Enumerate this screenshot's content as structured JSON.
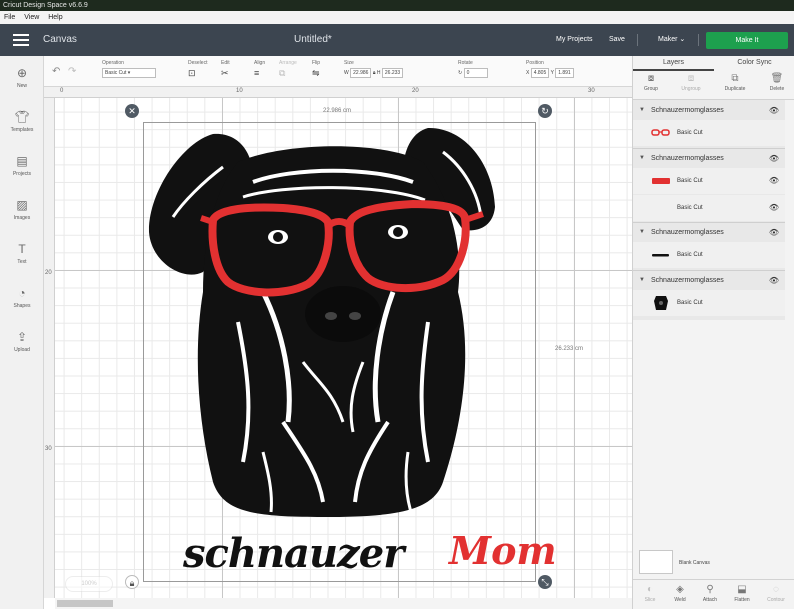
{
  "window": {
    "title": "Cricut Design Space v6.6.9"
  },
  "menu": {
    "items": [
      "File",
      "View",
      "Help"
    ]
  },
  "header": {
    "section": "Canvas",
    "document_title": "Untitled*",
    "my_projects": "My Projects",
    "save": "Save",
    "machine": "Maker",
    "make_it": "Make It"
  },
  "toolbar": {
    "operation_label": "Operation",
    "operation_value": "Basic Cut",
    "deselect_label": "Deselect",
    "edit_label": "Edit",
    "align_label": "Align",
    "arrange_label": "Arrange",
    "flip_label": "Flip",
    "size_label": "Size",
    "size_w_prefix": "W",
    "size_w": "22.986",
    "size_h_prefix": "H",
    "size_h": "26.233",
    "rotate_label": "Rotate",
    "rotate_value": "0",
    "position_label": "Position",
    "position_x_prefix": "X",
    "position_x": "4.805",
    "position_y_prefix": "Y",
    "position_y": "1.891"
  },
  "sidebar": {
    "items": [
      {
        "label": "New",
        "icon": "plus-circle-icon"
      },
      {
        "label": "Templates",
        "icon": "shirt-icon"
      },
      {
        "label": "Projects",
        "icon": "projects-icon"
      },
      {
        "label": "Images",
        "icon": "image-icon"
      },
      {
        "label": "Text",
        "icon": "text-icon"
      },
      {
        "label": "Shapes",
        "icon": "shapes-icon"
      },
      {
        "label": "Upload",
        "icon": "upload-icon"
      }
    ]
  },
  "ruler": {
    "ticks": [
      "0",
      "10",
      "20",
      "30"
    ],
    "left_ticks": [
      "20",
      "30"
    ]
  },
  "canvas": {
    "width_dim": "22.986 cm",
    "height_dim": "26.233 cm",
    "zoom": "100%",
    "text_black": "schnauzer",
    "text_red": "Mom"
  },
  "panel": {
    "tabs": [
      "Layers",
      "Color Sync"
    ],
    "tools": [
      "Group",
      "Ungroup",
      "Duplicate",
      "Delete"
    ],
    "layer_groups": [
      {
        "name": "Schnauzermomglasses",
        "items": [
          {
            "op": "Basic Cut",
            "thumb": "glasses"
          }
        ]
      },
      {
        "name": "Schnauzermomglasses",
        "items": [
          {
            "op": "Basic Cut",
            "thumb": "mom"
          },
          {
            "op": "Basic Cut",
            "thumb": "blank"
          }
        ]
      },
      {
        "name": "Schnauzermomglasses",
        "items": [
          {
            "op": "Basic Cut",
            "thumb": "schnauzer"
          }
        ]
      },
      {
        "name": "Schnauzermomglasses",
        "items": [
          {
            "op": "Basic Cut",
            "thumb": "dog"
          }
        ]
      }
    ],
    "blank_canvas": "Blank Canvas",
    "bottom_tools": [
      "Slice",
      "Weld",
      "Attach",
      "Flatten",
      "Contour"
    ]
  },
  "colors": {
    "accent": "#1da04e",
    "header_bg": "#3c4550",
    "glasses_red": "#e23131"
  }
}
